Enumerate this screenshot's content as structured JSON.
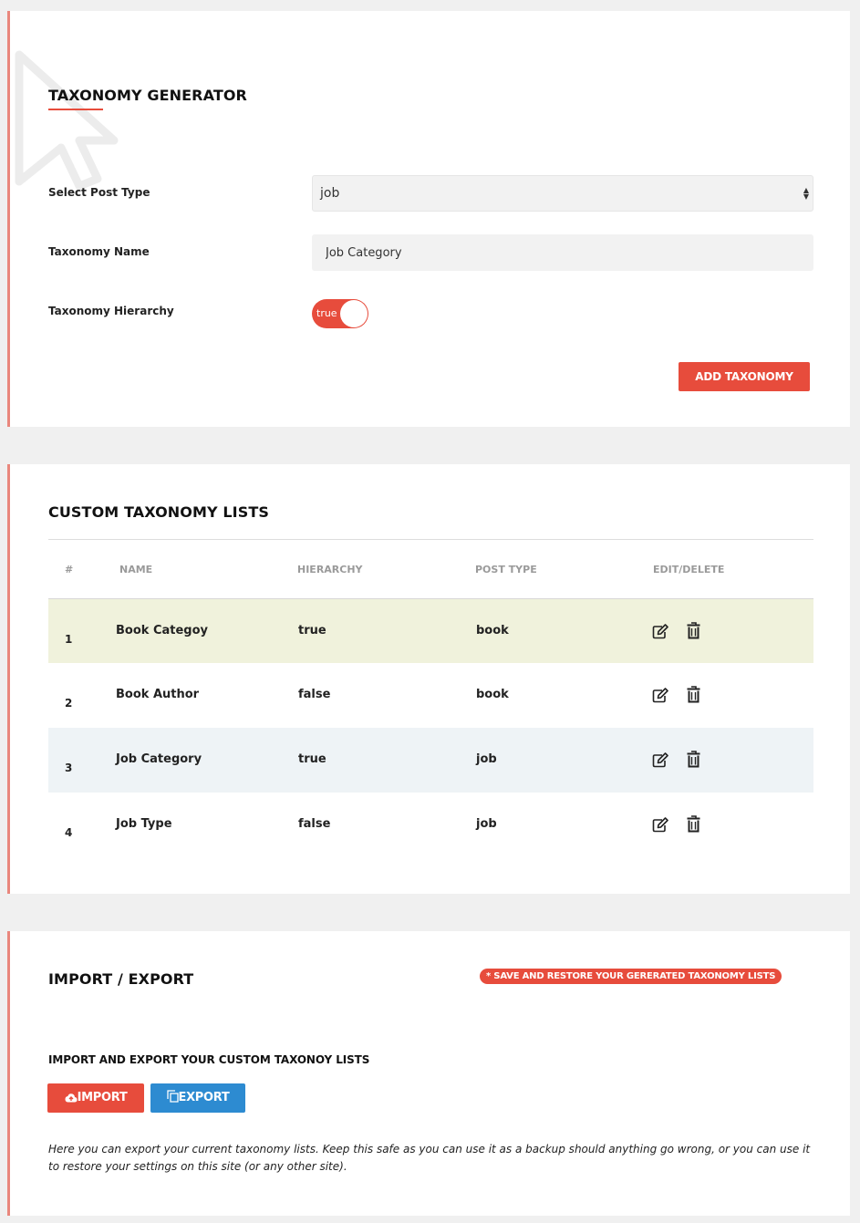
{
  "generator": {
    "title": "TAXONOMY GENERATOR",
    "post_type_label": "Select Post Type",
    "post_type_value": "job",
    "name_label": "Taxonomy Name",
    "name_value": "Job Category",
    "hierarchy_label": "Taxonomy Hierarchy",
    "hierarchy_toggle": "true",
    "add_button": "ADD TAXONOMY"
  },
  "list": {
    "title": "CUSTOM TAXONOMY LISTS",
    "columns": [
      "#",
      "NAME",
      "HIERARCHY",
      "POST TYPE",
      "EDIT/DELETE"
    ],
    "rows": [
      {
        "num": "1",
        "name": "Book Categoy",
        "hierarchy": "true",
        "post_type": "book"
      },
      {
        "num": "2",
        "name": "Book Author",
        "hierarchy": "false",
        "post_type": "book"
      },
      {
        "num": "3",
        "name": "Job Category",
        "hierarchy": "true",
        "post_type": "job"
      },
      {
        "num": "4",
        "name": "Job Type",
        "hierarchy": "false",
        "post_type": "job"
      }
    ]
  },
  "import_export": {
    "title": "IMPORT / EXPORT",
    "badge": "* SAVE AND RESTORE YOUR GERERATED TAXONOMY LISTS",
    "subtitle": "IMPORT AND EXPORT YOUR CUSTOM TAXONOY LISTS",
    "import_button": "IMPORT",
    "export_button": "EXPORT",
    "note": "Here you can export your current taxonomy lists. Keep this safe as you can use it as a backup should anything go wrong, or you can use it to restore your settings on this site (or any other site)."
  },
  "colors": {
    "accent_red": "#e74c3c",
    "accent_blue": "#2d8bd1",
    "card_border": "#e9877d"
  },
  "icons": [
    "edit-icon",
    "trash-icon",
    "cloud-upload-icon",
    "copy-icon",
    "cursor-arrow-icon"
  ]
}
